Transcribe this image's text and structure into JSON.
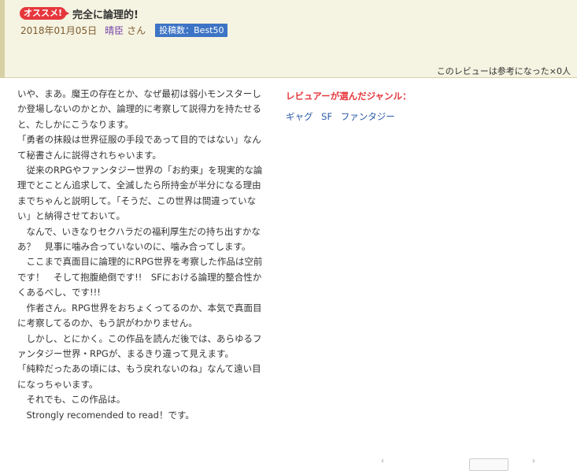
{
  "review": {
    "badge": "オススメ!",
    "title": "完全に論理的!",
    "date": "2018年01月05日",
    "reviewer": "晴臣",
    "honorific": "さん",
    "post_count_badge": "投稿数：Best50",
    "helpful_text": "このレビューは参考になった×0人"
  },
  "body": {
    "paragraphs": [
      "いや、まあ。魔王の存在とか、なぜ最初は弱小モンスターしか登場しないのかとか、論理的に考察して説得力を持たせると、たしかにこうなります。",
      "「勇者の抹殺は世界征服の手段であって目的ではない」なんて秘書さんに説得されちゃいます。",
      "　従来のRPGやファンタジー世界の「お約束」を現実的な論理でとことん追求して、全滅したら所持金が半分になる理由までちゃんと説明して。「そうだ、この世界は間違っていない」と納得させておいて。",
      "　なんで、いきなりセクハラだの福利厚生だの持ち出すかなあ？　見事に噛み合っていないのに、噛み合ってします。",
      "　ここまで真面目に論理的にRPG世界を考察した作品は空前です！　そして抱腹絶倒です!!　SFにおける論理的整合性かくあるべし、です!!!",
      "　作者さん。RPG世界をおちょくってるのか、本気で真面目に考察してるのか、もう訳がわかりません。",
      "　しかし、とにかく。この作品を読んだ後では、あらゆるファンタジー世界・RPGが、まるきり違って見えます。",
      "「純粋だったあの頃には、もう戻れないのね」なんて遠い目になっちゃいます。",
      "　それでも、この作品は。",
      "　Strongly recomended to read！です。"
    ]
  },
  "genres": {
    "heading": "レビュアーが選んだジャンル：",
    "items": [
      "ギャグ",
      "SF",
      "ファンタジー"
    ]
  },
  "colors": {
    "header_bg": "#f5f3e1",
    "header_border": "#d7d0a5",
    "badge_red": "#e6373d",
    "post_badge_blue": "#3d74c5",
    "reviewer_purple": "#7744aa",
    "genre_link_blue": "#2a5aa8"
  }
}
